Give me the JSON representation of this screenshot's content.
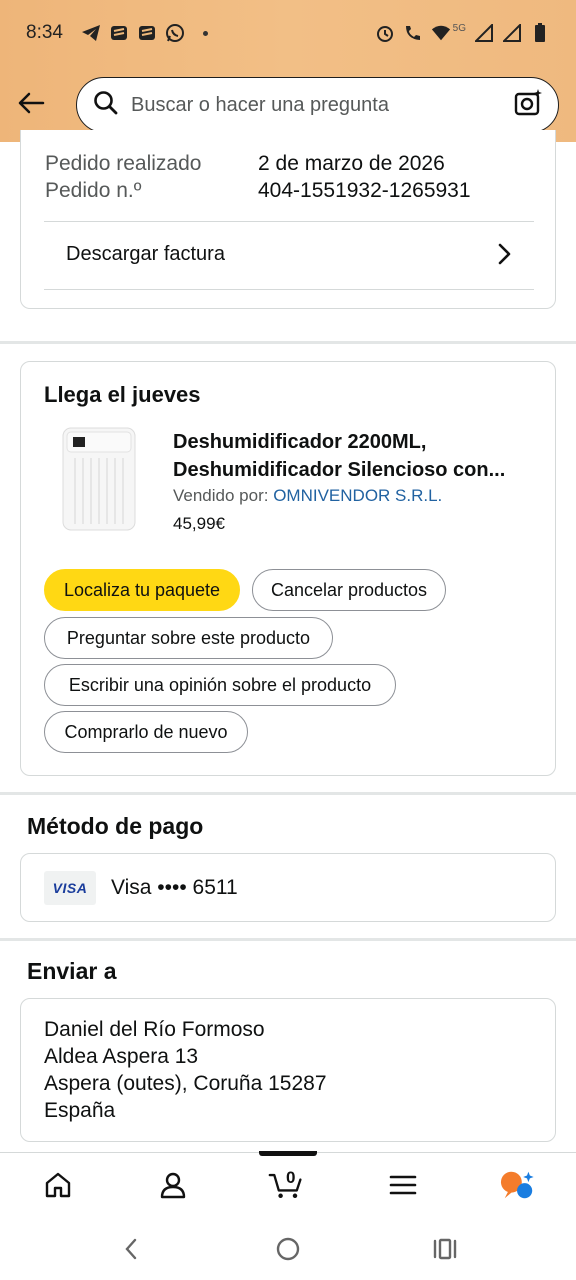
{
  "status_bar": {
    "time": "8:34",
    "network_label": "5G"
  },
  "search": {
    "placeholder": "Buscar o hacer una pregunta"
  },
  "order_info": {
    "placed_label": "Pedido realizado",
    "placed_value": "2 de marzo de 2026",
    "number_label": "Pedido n.º",
    "number_value": "404-1551932-1265931",
    "invoice_label": "Descargar factura"
  },
  "shipment": {
    "title": "Llega el jueves",
    "product_title_line1": "Deshumidificador 2200ML,",
    "product_title_line2": "Deshumidificador Silencioso con...",
    "sold_by_label": "Vendido por:",
    "seller": "OMNIVENDOR S.R.L.",
    "price": "45,99€",
    "buttons": {
      "track": "Localiza tu paquete",
      "cancel": "Cancelar productos",
      "ask": "Preguntar sobre este producto",
      "review": "Escribir una opinión sobre el producto",
      "buy_again": "Comprarlo de nuevo"
    }
  },
  "payment": {
    "title": "Método de pago",
    "card_brand": "VISA",
    "card_text": "Visa •••• 6511"
  },
  "shipping_address": {
    "title": "Enviar a",
    "lines": [
      "Daniel del Río Formoso",
      "Aldea Aspera 13",
      "Aspera (outes), Coruña 15287",
      "España"
    ]
  },
  "bottom_nav": {
    "cart_count": "0"
  },
  "colors": {
    "header_bg": "#f0b97a",
    "primary_button": "#ffd814",
    "link": "#2162a1"
  }
}
